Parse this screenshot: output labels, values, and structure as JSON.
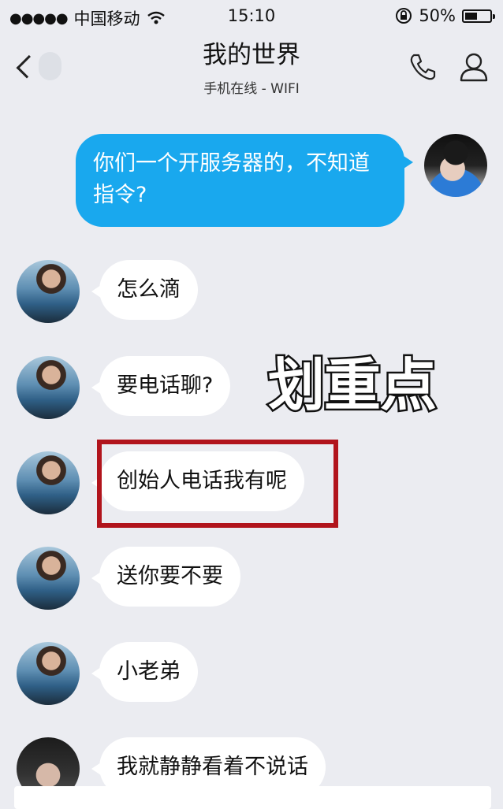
{
  "status_bar": {
    "signal": "●●●●●",
    "carrier": "中国移动",
    "wifi_icon": "wifi-icon",
    "time": "15:10",
    "battery_percent": "50%",
    "battery_level": 0.5
  },
  "nav": {
    "title": "我的世界",
    "subtitle": "手机在线 - WIFI"
  },
  "messages": [
    {
      "side": "right",
      "text": "你们一个开服务器的，不知道指令?"
    },
    {
      "side": "left",
      "text": "怎么滴"
    },
    {
      "side": "left",
      "text": "要电话聊?"
    },
    {
      "side": "left",
      "text": "创始人电话我有呢"
    },
    {
      "side": "left",
      "text": "送你要不要"
    },
    {
      "side": "left",
      "text": "小老弟"
    },
    {
      "side": "left",
      "text": "我就静静看着不说话"
    }
  ],
  "annotation": {
    "emphasis_text": "划重点",
    "highlight_color": "#b1141c"
  },
  "colors": {
    "sent_bubble": "#19a8ee",
    "background": "#ebecf1"
  }
}
